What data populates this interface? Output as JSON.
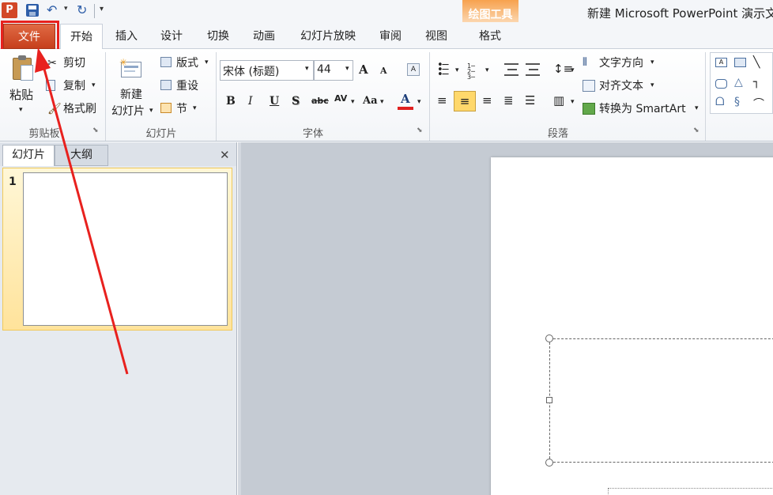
{
  "title_bar": {
    "app_icon": "P",
    "window_title": "新建 Microsoft PowerPoint 演示文"
  },
  "contextual_tab": {
    "group_label": "绘图工具",
    "tab_label": "格式"
  },
  "tabs": [
    "文件",
    "开始",
    "插入",
    "设计",
    "切换",
    "动画",
    "幻灯片放映",
    "审阅",
    "视图"
  ],
  "clipboard": {
    "paste": "粘贴",
    "cut": "剪切",
    "copy": "复制",
    "format_painter": "格式刷",
    "group_label": "剪贴板"
  },
  "slides_group": {
    "new_slide_line1": "新建",
    "new_slide_line2": "幻灯片",
    "layout": "版式",
    "reset": "重设",
    "section": "节",
    "group_label": "幻灯片"
  },
  "font_group": {
    "font_name": "宋体 (标题)",
    "font_size": "44",
    "bold": "B",
    "italic": "I",
    "underline": "U",
    "shadow": "S",
    "strikethrough": "abc",
    "spacing": "AV",
    "change_case": "Aa",
    "font_color": "A",
    "grow": "A",
    "shrink": "A",
    "group_label": "字体"
  },
  "paragraph_group": {
    "text_direction": "文字方向",
    "align_text": "对齐文本",
    "convert_smartart": "转换为 SmartArt",
    "group_label": "段落"
  },
  "left_pane": {
    "tab_slides": "幻灯片",
    "tab_outline": "大纲",
    "close": "✕",
    "slide_number": "1"
  },
  "colors": {
    "file_tab": "#d24726",
    "annotation": "#e8211e",
    "contextual": "#f59a42",
    "highlight": "#ffd86b",
    "font_color_bar": "#e02020"
  }
}
